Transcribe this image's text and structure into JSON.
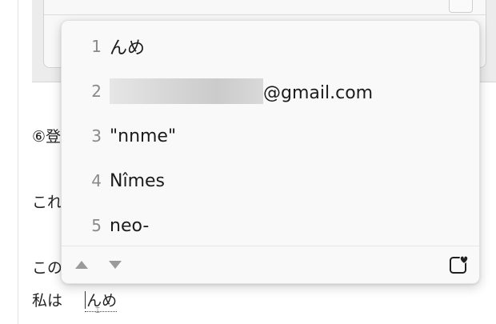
{
  "document": {
    "line1_partial": "⑥登",
    "line2_partial": "これ",
    "line3_partial": "この",
    "line4_prefix": "私は",
    "composing_text": "んめ"
  },
  "ime": {
    "candidates": [
      {
        "index": "1",
        "text": "んめ"
      },
      {
        "index": "2",
        "text": "@gmail.com",
        "redacted_prefix": true
      },
      {
        "index": "3",
        "text": "\"nnme\""
      },
      {
        "index": "4",
        "text": "Nîmes"
      },
      {
        "index": "5",
        "text": "neo-"
      }
    ],
    "footer": {
      "prev_icon": "triangle-up-icon",
      "next_icon": "triangle-down-icon",
      "favorite_icon": "heart-box-icon"
    }
  }
}
